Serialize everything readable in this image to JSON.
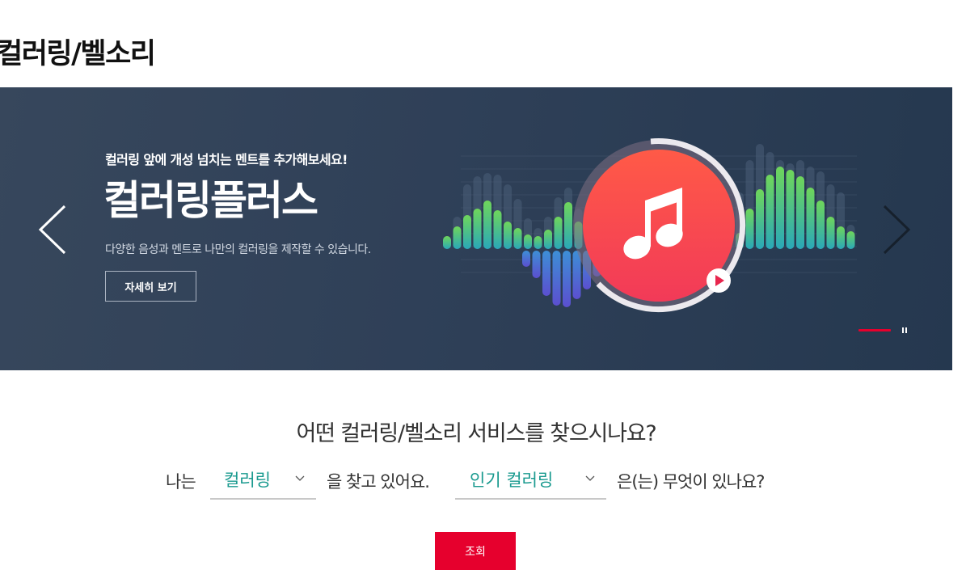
{
  "page": {
    "title": "컬러링/벨소리"
  },
  "banner": {
    "subtitle": "컬러링 앞에 개성 넘치는 멘트를 추가해보세요!",
    "headline": "컬러링플러스",
    "description": "다양한 음성과 멘트로 나만의 컬러링을 제작할 수 있습니다.",
    "detail_button": "자세히 보기",
    "icons": {
      "prev": "chevron-left-icon",
      "next": "chevron-right-icon",
      "note": "music-note-icon",
      "play": "play-icon",
      "pause": "pause-icon"
    },
    "colors": {
      "background": "#2f4058",
      "accent": "#ff4a4a",
      "indicator_active": "#e6002d"
    }
  },
  "finder": {
    "question": "어떤 컬러링/벨소리 서비스를 찾으시나요?",
    "prefix": "나는",
    "select1": "컬러링",
    "middle": "을 찾고 있어요.",
    "select2": "인기 컬러링",
    "suffix": "은(는) 무엇이 있나요?",
    "search_button": "조회",
    "colors": {
      "select_text": "#1a9a8f",
      "button": "#e6002d"
    }
  }
}
